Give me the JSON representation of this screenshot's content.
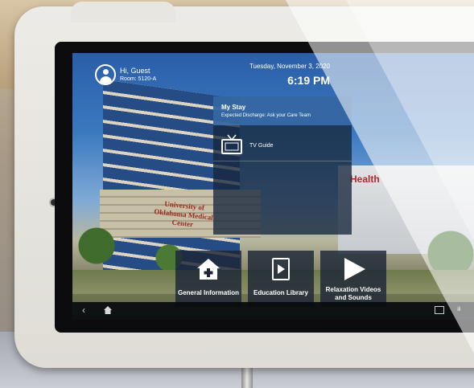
{
  "header": {
    "greeting": "Hi, Guest",
    "room": "Room: 5120-A",
    "date": "Tuesday, November 3, 2020",
    "time": "6:19 PM"
  },
  "my_stay": {
    "title": "My Stay",
    "subtitle": "Expected Discharge: Ask your Care Team",
    "items": [
      {
        "label": "TV Guide",
        "icon": "tv-icon"
      }
    ]
  },
  "tiles": [
    {
      "label": "General Information",
      "icon": "house-plus-icon"
    },
    {
      "label": "Education Library",
      "icon": "video-file-icon"
    },
    {
      "label": "Relaxation Videos and Sounds",
      "icon": "play-icon"
    }
  ],
  "navbar": {
    "back_icon": "back-chevron-icon",
    "home_icon": "home-icon"
  },
  "background": {
    "building_sign": "University of Oklahoma Medical Center",
    "health_sign": "Health"
  }
}
